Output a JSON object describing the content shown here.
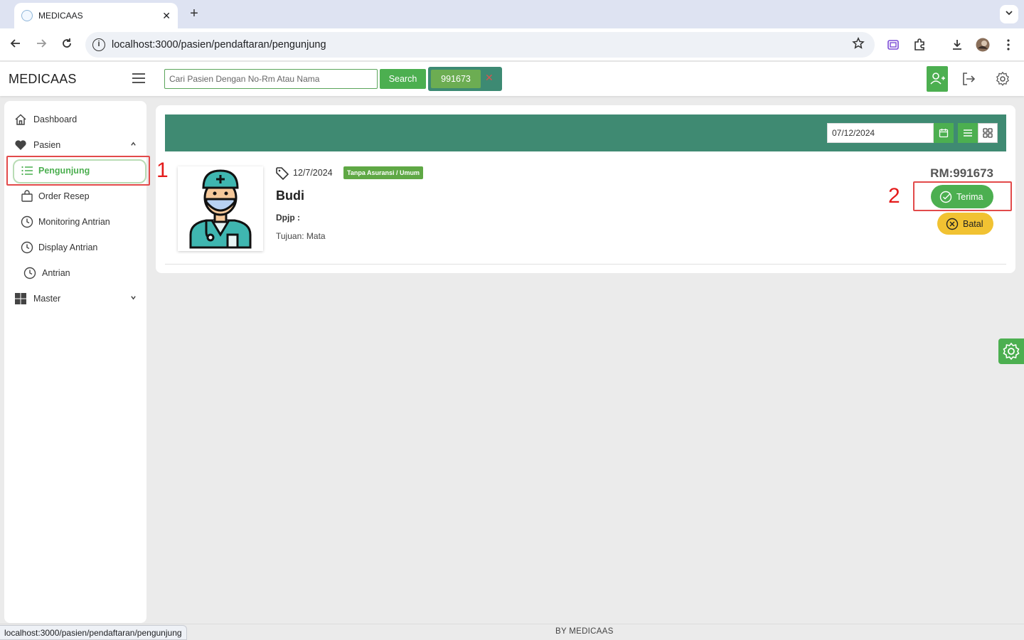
{
  "browser": {
    "tab_title": "MEDICAAS",
    "tab_close": "✕",
    "new_tab": "+",
    "url": "localhost:3000/pasien/pendaftaran/pengunjung",
    "status_url": "localhost:3000/pasien/pendaftaran/pengunjung"
  },
  "header": {
    "brand": "MEDICAAS",
    "search_placeholder": "Cari Pasien Dengan No-Rm Atau Nama",
    "search_button": "Search",
    "rm_chip": "991673",
    "rm_clear": "✕"
  },
  "sidebar": {
    "items": [
      {
        "label": "Dashboard",
        "icon": "home-icon"
      },
      {
        "label": "Pasien",
        "icon": "heart-icon",
        "expanded": true
      },
      {
        "label": "Pengunjung",
        "icon": "list-icon",
        "active": true
      },
      {
        "label": "Order Resep",
        "icon": "bag-icon"
      },
      {
        "label": "Monitoring Antrian",
        "icon": "clock-icon"
      },
      {
        "label": "Display Antrian",
        "icon": "clock-icon"
      },
      {
        "label": "Antrian",
        "icon": "clock-icon"
      },
      {
        "label": "Master",
        "icon": "grid-icon",
        "expanded": false
      }
    ]
  },
  "filter": {
    "date": "07/12/2024"
  },
  "patient": {
    "date": "12/7/2024",
    "insurance": "Tanpa Asuransi / Umum",
    "name": "Budi",
    "dpjp": "Dpjp :",
    "tujuan": "Tujuan: Mata",
    "rm": "RM:991673",
    "accept_label": "Terima",
    "cancel_label": "Batal"
  },
  "annotations": [
    "1",
    "2"
  ],
  "footer": {
    "by": "BY  MEDICAAS"
  },
  "colors": {
    "primary_green": "#4caf50",
    "header_teal": "#3f8a72",
    "warning_yellow": "#f1c232",
    "annotation_red": "#e24a4a"
  }
}
